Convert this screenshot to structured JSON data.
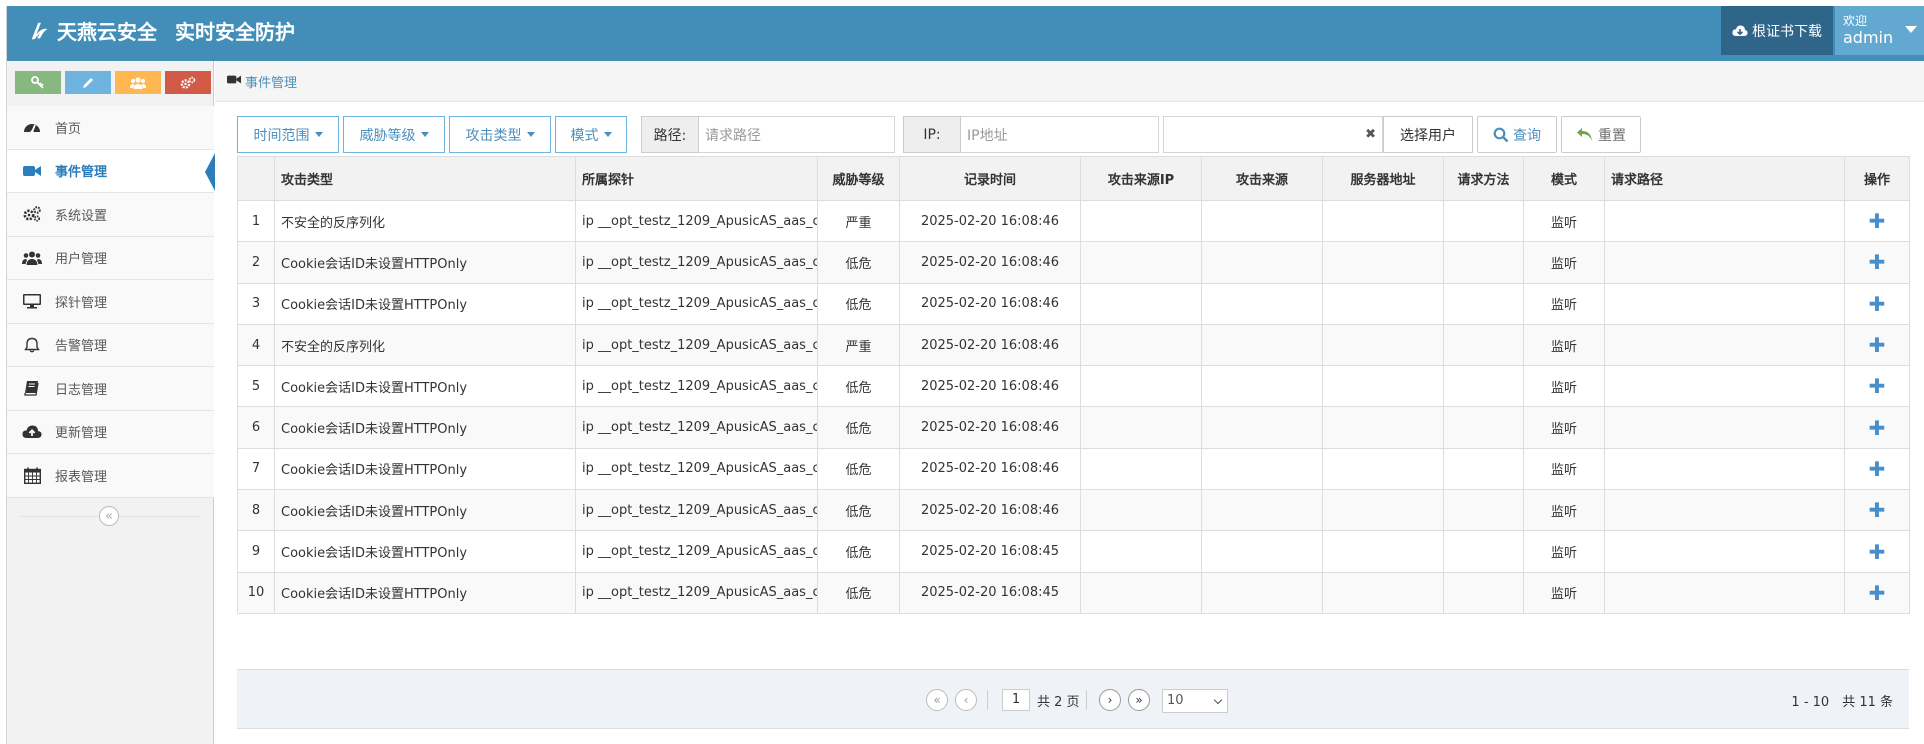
{
  "navbar": {
    "brand": "天燕云安全",
    "slogan": "实时安全防护",
    "cert_button": "根证书下载",
    "welcome": "欢迎",
    "username": "admin"
  },
  "sidebar": {
    "shortcuts": [
      {
        "icon": "key-icon",
        "color": "#87b87f"
      },
      {
        "icon": "pencil-icon",
        "color": "#6fb3e0"
      },
      {
        "icon": "users-icon",
        "color": "#ffb752"
      },
      {
        "icon": "cogs-icon",
        "color": "#d15b47"
      }
    ],
    "items": [
      {
        "label": "首页",
        "icon": "dashboard-icon"
      },
      {
        "label": "事件管理",
        "icon": "video-camera-icon"
      },
      {
        "label": "系统设置",
        "icon": "cogs-icon"
      },
      {
        "label": "用户管理",
        "icon": "users-icon"
      },
      {
        "label": "探针管理",
        "icon": "desktop-icon"
      },
      {
        "label": "告警管理",
        "icon": "bell-icon"
      },
      {
        "label": "日志管理",
        "icon": "book-icon"
      },
      {
        "label": "更新管理",
        "icon": "cloud-upload-icon"
      },
      {
        "label": "报表管理",
        "icon": "calendar-icon"
      }
    ],
    "active_index": 1,
    "collapse_glyph": "«"
  },
  "breadcrumb": {
    "current": "事件管理"
  },
  "toolbar": {
    "time_range": "时间范围",
    "threat_level": "威胁等级",
    "attack_type": "攻击类型",
    "mode": "模式",
    "path_label": "路径:",
    "path_placeholder": "请求路径",
    "ip_label": "IP:",
    "ip_placeholder": "IP地址",
    "user_value": "",
    "clear_glyph": "✖",
    "select_user": "选择用户",
    "query": "查询",
    "reset": "重置"
  },
  "table": {
    "headers": [
      "攻击类型",
      "所属探针",
      "威胁等级",
      "记录时间",
      "攻击来源IP",
      "攻击来源",
      "服务器地址",
      "请求方法",
      "模式",
      "请求路径",
      "操作"
    ],
    "rows": [
      {
        "no": "1",
        "type": "不安全的反序列化",
        "probe": "ip __opt_testz_1209_ApusicAS_aas_c",
        "level": "严重",
        "time": "2025-02-20 16:08:46",
        "src_ip": "",
        "src": "",
        "server": "",
        "method": "",
        "mode": "监听",
        "path": ""
      },
      {
        "no": "2",
        "type": "Cookie会话ID未设置HTTPOnly",
        "probe": "ip __opt_testz_1209_ApusicAS_aas_c",
        "level": "低危",
        "time": "2025-02-20 16:08:46",
        "src_ip": "",
        "src": "",
        "server": "",
        "method": "",
        "mode": "监听",
        "path": ""
      },
      {
        "no": "3",
        "type": "Cookie会话ID未设置HTTPOnly",
        "probe": "ip __opt_testz_1209_ApusicAS_aas_c",
        "level": "低危",
        "time": "2025-02-20 16:08:46",
        "src_ip": "",
        "src": "",
        "server": "",
        "method": "",
        "mode": "监听",
        "path": ""
      },
      {
        "no": "4",
        "type": "不安全的反序列化",
        "probe": "ip __opt_testz_1209_ApusicAS_aas_c",
        "level": "严重",
        "time": "2025-02-20 16:08:46",
        "src_ip": "",
        "src": "",
        "server": "",
        "method": "",
        "mode": "监听",
        "path": ""
      },
      {
        "no": "5",
        "type": "Cookie会话ID未设置HTTPOnly",
        "probe": "ip __opt_testz_1209_ApusicAS_aas_c",
        "level": "低危",
        "time": "2025-02-20 16:08:46",
        "src_ip": "",
        "src": "",
        "server": "",
        "method": "",
        "mode": "监听",
        "path": ""
      },
      {
        "no": "6",
        "type": "Cookie会话ID未设置HTTPOnly",
        "probe": "ip __opt_testz_1209_ApusicAS_aas_c",
        "level": "低危",
        "time": "2025-02-20 16:08:46",
        "src_ip": "",
        "src": "",
        "server": "",
        "method": "",
        "mode": "监听",
        "path": ""
      },
      {
        "no": "7",
        "type": "Cookie会话ID未设置HTTPOnly",
        "probe": "ip __opt_testz_1209_ApusicAS_aas_c",
        "level": "低危",
        "time": "2025-02-20 16:08:46",
        "src_ip": "",
        "src": "",
        "server": "",
        "method": "",
        "mode": "监听",
        "path": ""
      },
      {
        "no": "8",
        "type": "Cookie会话ID未设置HTTPOnly",
        "probe": "ip __opt_testz_1209_ApusicAS_aas_c",
        "level": "低危",
        "time": "2025-02-20 16:08:46",
        "src_ip": "",
        "src": "",
        "server": "",
        "method": "",
        "mode": "监听",
        "path": ""
      },
      {
        "no": "9",
        "type": "Cookie会话ID未设置HTTPOnly",
        "probe": "ip __opt_testz_1209_ApusicAS_aas_c",
        "level": "低危",
        "time": "2025-02-20 16:08:45",
        "src_ip": "",
        "src": "",
        "server": "",
        "method": "",
        "mode": "监听",
        "path": ""
      },
      {
        "no": "10",
        "type": "Cookie会话ID未设置HTTPOnly",
        "probe": "ip __opt_testz_1209_ApusicAS_aas_c",
        "level": "低危",
        "time": "2025-02-20 16:08:45",
        "src_ip": "",
        "src": "",
        "server": "",
        "method": "",
        "mode": "监听",
        "path": ""
      }
    ],
    "action_glyph": "✚"
  },
  "pager": {
    "current_page": "1",
    "total_pages": "共 2 页",
    "page_size": "10",
    "info": "1 - 10　共 11 条"
  },
  "colors": {
    "navbar": "#438eb9",
    "accent": "#2b7dbc",
    "plus": "#478fca"
  }
}
